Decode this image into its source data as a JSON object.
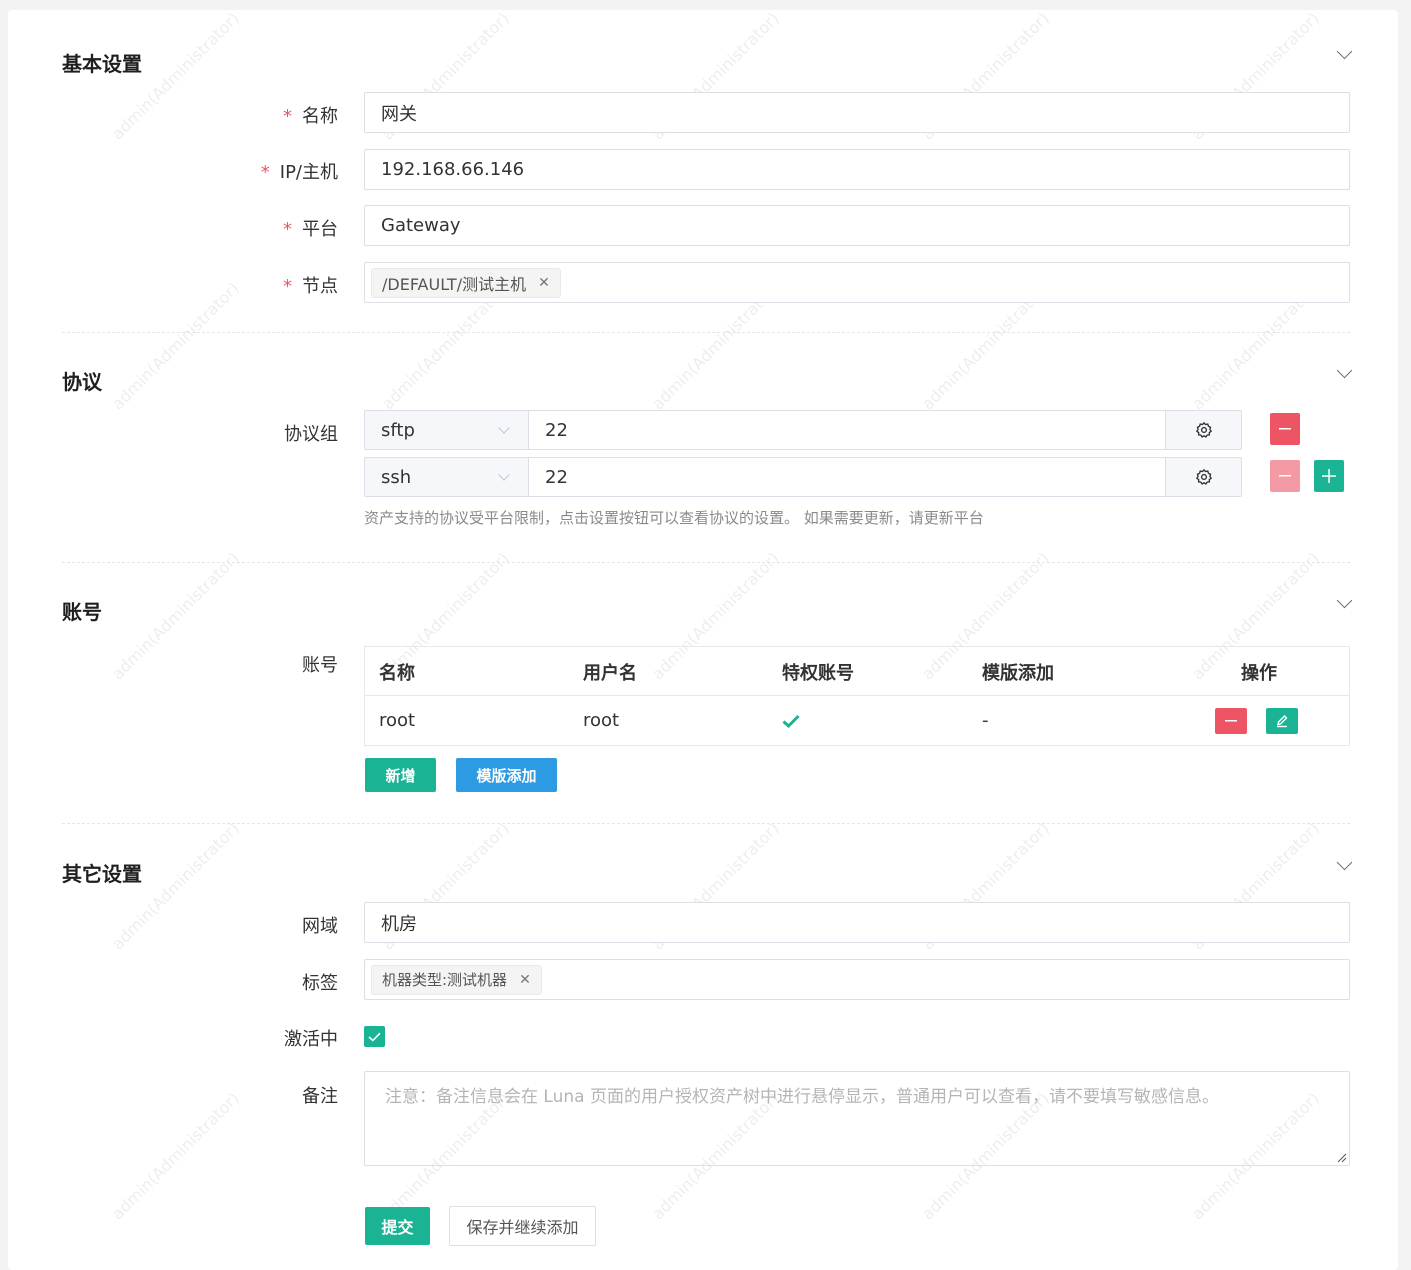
{
  "watermark_text": "admin(Administrator)",
  "colors": {
    "accent_green": "#1ab394",
    "danger_red": "#ed5565",
    "info_blue": "#1c84c6"
  },
  "basic": {
    "title": "基本设置",
    "name_label": "名称",
    "name_value": "网关",
    "host_label": "IP/主机",
    "host_value": "192.168.66.146",
    "platform_label": "平台",
    "platform_value": "Gateway",
    "node_label": "节点",
    "node_tag": "/DEFAULT/测试主机",
    "required_mark": "*"
  },
  "protocol": {
    "title": "协议",
    "group_label": "协议组",
    "rows": [
      {
        "protocol": "sftp",
        "port": "22"
      },
      {
        "protocol": "ssh",
        "port": "22"
      }
    ],
    "help": "资产支持的协议受平台限制，点击设置按钮可以查看协议的设置。 如果需要更新，请更新平台"
  },
  "accounts": {
    "title": "账号",
    "label": "账号",
    "columns": [
      "名称",
      "用户名",
      "特权账号",
      "模版添加",
      "操作"
    ],
    "rows": [
      {
        "name": "root",
        "username": "root",
        "privileged": true,
        "template": "-"
      }
    ],
    "add_button": "新增",
    "template_button": "模版添加"
  },
  "other": {
    "title": "其它设置",
    "domain_label": "网域",
    "domain_value": "机房",
    "labels_label": "标签",
    "labels_tag": "机器类型:测试机器",
    "active_label": "激活中",
    "active_checked": true,
    "comment_label": "备注",
    "comment_placeholder": "注意：备注信息会在 Luna 页面的用户授权资产树中进行悬停显示，普通用户可以查看，请不要填写敏感信息。"
  },
  "footer": {
    "submit": "提交",
    "save_continue": "保存并继续添加"
  }
}
